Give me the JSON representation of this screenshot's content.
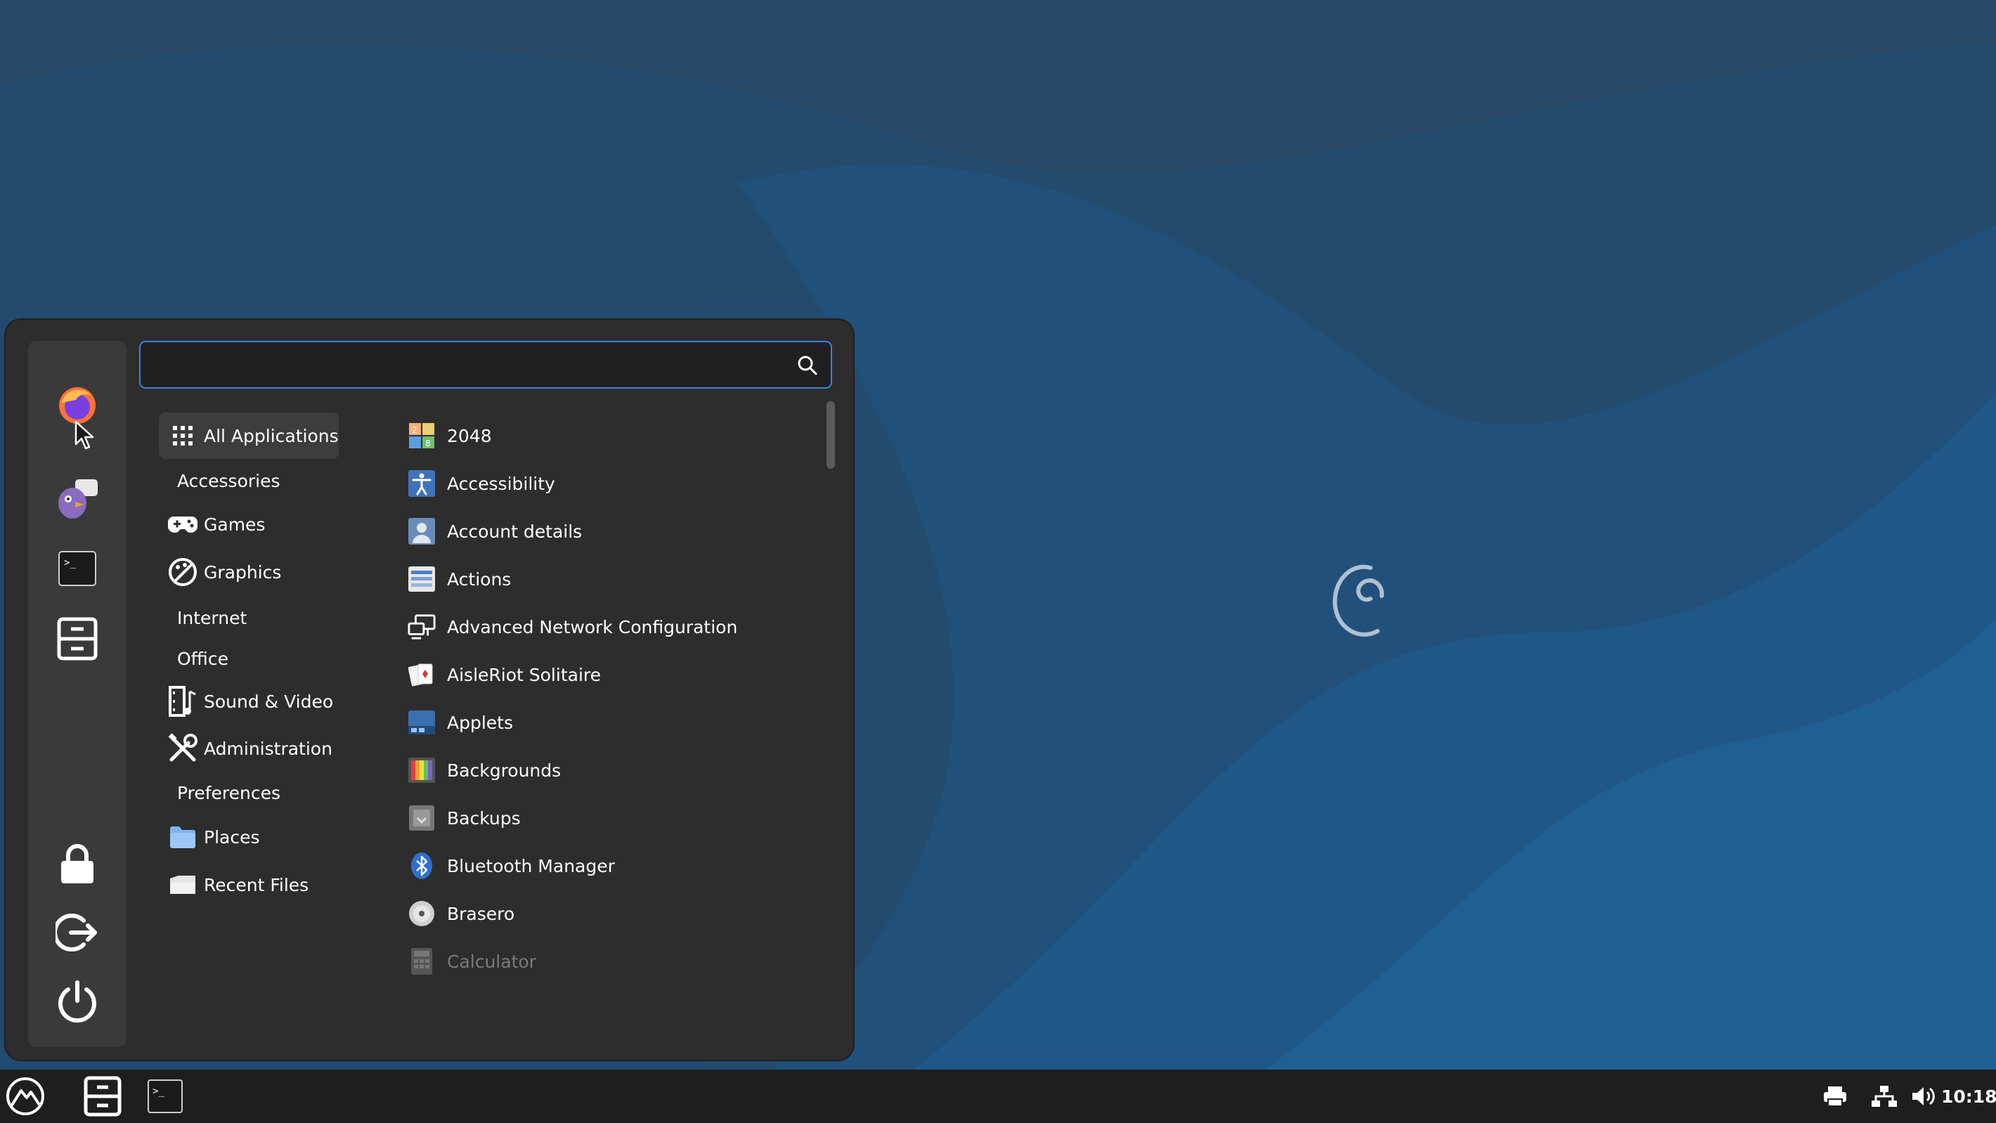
{
  "search": {
    "value": "",
    "placeholder": ""
  },
  "categories": [
    {
      "label": "All Applications",
      "icon": "grid-icon",
      "active": true
    },
    {
      "label": "Accessories",
      "icon": ""
    },
    {
      "label": "Games",
      "icon": "gamepad-icon"
    },
    {
      "label": "Graphics",
      "icon": "palette-icon"
    },
    {
      "label": "Internet",
      "icon": ""
    },
    {
      "label": "Office",
      "icon": ""
    },
    {
      "label": "Sound & Video",
      "icon": "film-music-icon"
    },
    {
      "label": "Administration",
      "icon": "tools-icon"
    },
    {
      "label": "Preferences",
      "icon": ""
    },
    {
      "label": "Places",
      "icon": "folder-icon"
    },
    {
      "label": "Recent Files",
      "icon": "recent-files-icon"
    }
  ],
  "apps": [
    {
      "label": "2048",
      "icon": "game-2048-icon"
    },
    {
      "label": "Accessibility",
      "icon": "accessibility-icon"
    },
    {
      "label": "Account details",
      "icon": "user-account-icon"
    },
    {
      "label": "Actions",
      "icon": "actions-icon"
    },
    {
      "label": "Advanced Network Configuration",
      "icon": "network-config-icon"
    },
    {
      "label": "AisleRiot Solitaire",
      "icon": "cards-icon"
    },
    {
      "label": "Applets",
      "icon": "applets-icon"
    },
    {
      "label": "Backgrounds",
      "icon": "backgrounds-icon"
    },
    {
      "label": "Backups",
      "icon": "backups-icon"
    },
    {
      "label": "Bluetooth Manager",
      "icon": "bluetooth-icon"
    },
    {
      "label": "Brasero",
      "icon": "disc-icon"
    },
    {
      "label": "Calculator",
      "icon": "calculator-icon",
      "dim": true
    }
  ],
  "favorites": [
    "firefox-icon",
    "pidgin-icon",
    "terminal-icon",
    "file-manager-icon"
  ],
  "session": [
    "lock-icon",
    "logout-icon",
    "power-icon"
  ],
  "panel": {
    "launchers": [
      "menu-icon",
      "file-manager-icon",
      "terminal-icon"
    ],
    "tray": [
      "printer-icon",
      "network-icon",
      "volume-icon"
    ],
    "clock": "10:18"
  },
  "colors": {
    "accent": "#3584e4",
    "menu_bg": "#2d2d2d",
    "panel_bg": "#1e1e1e",
    "desktop": "#24476a"
  }
}
